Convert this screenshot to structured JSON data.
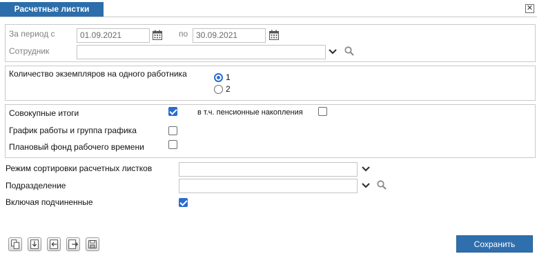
{
  "window": {
    "title": "Расчетные листки",
    "close_symbol": "✕"
  },
  "period": {
    "label": "За период с",
    "from_value": "01.09.2021",
    "to_label": "по",
    "to_value": "30.09.2021"
  },
  "employee": {
    "label": "Сотрудник",
    "value": ""
  },
  "copies": {
    "label": "Количество экземпляров на одного работника",
    "options": [
      {
        "label": "1",
        "selected": true
      },
      {
        "label": "2",
        "selected": false
      }
    ]
  },
  "options": {
    "cumulative_label": "Совокупные итоги",
    "cumulative_checked": true,
    "pension_label": "в т.ч. пенсионные накопления",
    "pension_checked": false,
    "schedule_label": "График работы и группа графика",
    "schedule_checked": false,
    "fund_label": "Плановый фонд рабочего времени",
    "fund_checked": false
  },
  "sort_mode": {
    "label": "Режим сортировки расчетных листков",
    "value": ""
  },
  "department": {
    "label": "Подразделение",
    "value": ""
  },
  "include_sub": {
    "label": "Включая подчиненные",
    "checked": true
  },
  "footer": {
    "save_label": "Сохранить",
    "tools": [
      "copy-icon",
      "import-icon",
      "enter-icon",
      "export-icon",
      "save-disk-icon"
    ]
  },
  "colors": {
    "accent": "#2c6eab",
    "check": "#2b6cd1"
  }
}
